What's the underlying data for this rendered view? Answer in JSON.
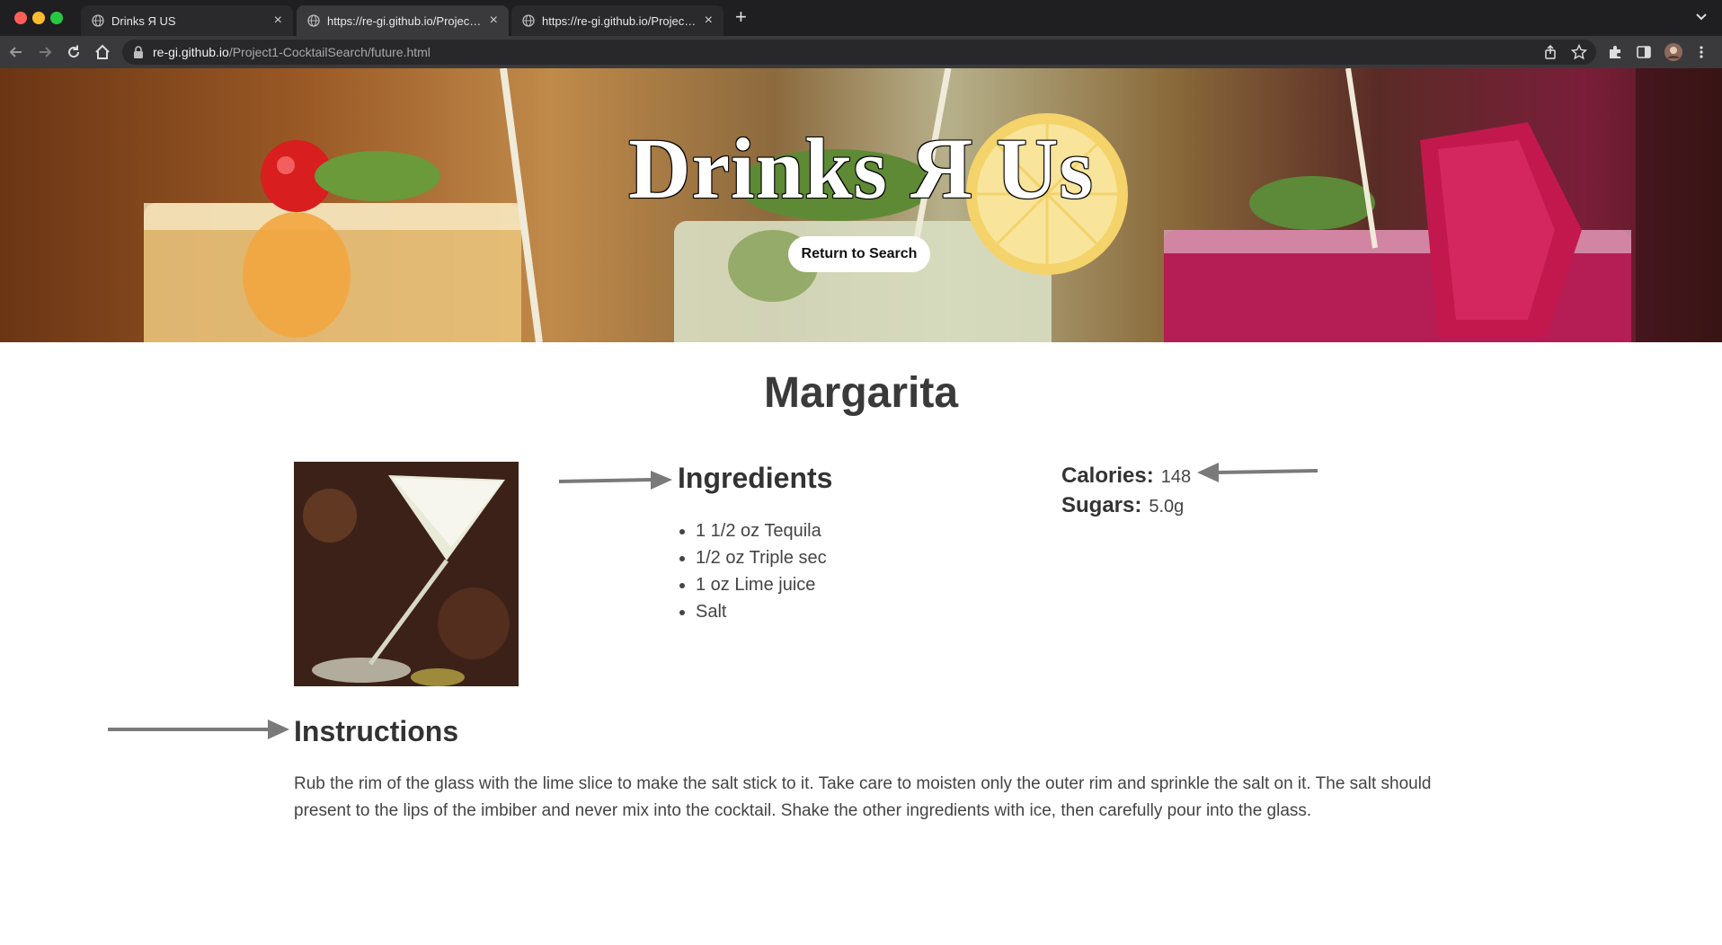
{
  "browser": {
    "tabs": [
      {
        "title": "Drinks Я US"
      },
      {
        "title": "https://re-gi.github.io/Project1-"
      },
      {
        "title": "https://re-gi.github.io/Project1-"
      }
    ],
    "url_host": "re-gi.github.io",
    "url_path": "/Project1-CocktailSearch/future.html"
  },
  "hero": {
    "title": "Drinks Я Us",
    "return_button": "Return to Search"
  },
  "drink": {
    "name": "Margarita",
    "ingredients_heading": "Ingredients",
    "ingredients": [
      "1 1/2 oz Tequila",
      "1/2 oz Triple sec",
      "1 oz Lime juice",
      "Salt"
    ],
    "calories_label": "Calories:",
    "calories_value": "148",
    "sugars_label": "Sugars:",
    "sugars_value": "5.0g",
    "instructions_heading": "Instructions",
    "instructions": "Rub the rim of the glass with the lime slice to make the salt stick to it. Take care to moisten only the outer rim and sprinkle the salt on it. The salt should present to the lips of the imbiber and never mix into the cocktail. Shake the other ingredients with ice, then carefully pour into the glass."
  }
}
